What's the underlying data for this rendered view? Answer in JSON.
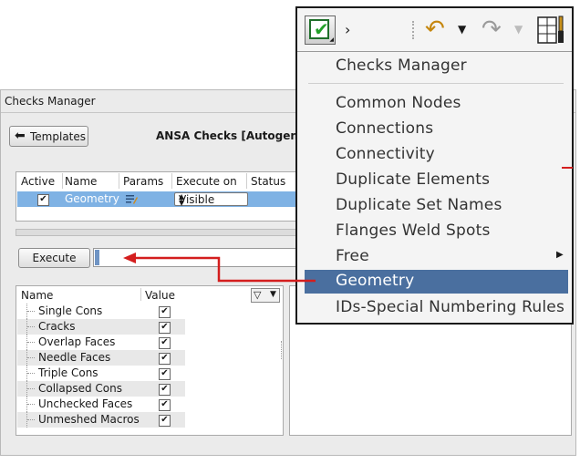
{
  "window": {
    "title": "Checks Manager",
    "templates_button": "Templates",
    "checks_title": "ANSA Checks [Autogen"
  },
  "grid": {
    "headers": [
      "Active",
      "Name",
      "Params",
      "Execute on",
      "Status"
    ],
    "row": {
      "active": true,
      "name": "Geometry",
      "execute_on": "Visible"
    }
  },
  "execute": {
    "label": "Execute"
  },
  "tree": {
    "headers": {
      "name": "Name",
      "value": "Value"
    },
    "items": [
      {
        "label": "Single Cons",
        "checked": true
      },
      {
        "label": "Cracks",
        "checked": true
      },
      {
        "label": "Overlap Faces",
        "checked": true
      },
      {
        "label": "Needle Faces",
        "checked": true
      },
      {
        "label": "Triple Cons",
        "checked": true
      },
      {
        "label": "Collapsed Cons",
        "checked": true
      },
      {
        "label": "Unchecked Faces",
        "checked": true
      },
      {
        "label": "Unmeshed Macros",
        "checked": true
      }
    ]
  },
  "toolbar": {
    "icons": [
      "check-icon",
      "more-arrow-icon",
      "undo-icon",
      "redo-icon",
      "tools-icon"
    ]
  },
  "menu": {
    "title_item": "Checks Manager",
    "items": [
      "Common Nodes",
      "Connections",
      "Connectivity",
      "Duplicate Elements",
      "Duplicate Set Names",
      "Flanges Weld Spots",
      "Free",
      "Geometry",
      "IDs-Special Numbering Rules"
    ],
    "highlighted": "Geometry",
    "submenu_item": "Free"
  },
  "colors": {
    "selection": "#7fb2e4",
    "menu_highlight": "#4a6f9f",
    "annotation_arrow": "#d41e1e",
    "check_green": "#22a128"
  }
}
